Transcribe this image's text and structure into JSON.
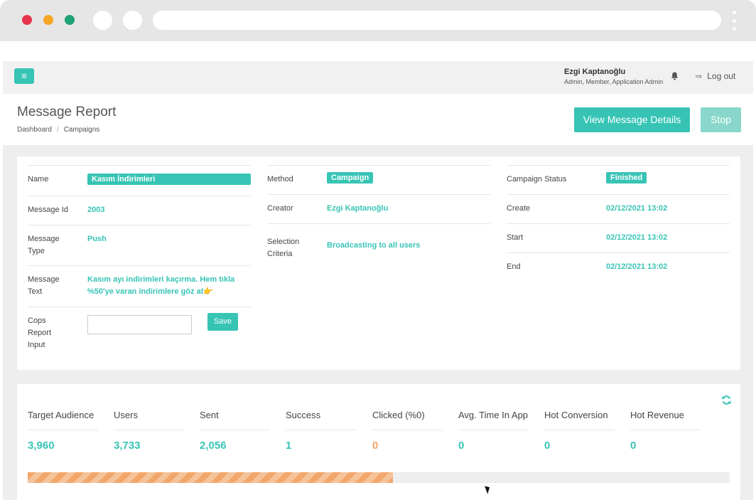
{
  "header": {
    "menu_icon": "hamburger-icon",
    "user_name": "Ezgi Kaptanoğlu",
    "user_role": "Admin, Member, Application Admin",
    "bell_icon": "bell-icon",
    "logout_label": "Log out"
  },
  "page": {
    "title": "Message Report",
    "breadcrumb": [
      "Dashboard",
      "Campaigns"
    ],
    "view_details_label": "View Message Details",
    "stop_label": "Stop"
  },
  "details": {
    "name_label": "Name",
    "name_value": "Kasım İndirimleri",
    "message_id_label": "Message Id",
    "message_id_value": "2003",
    "message_type_label_1": "Message",
    "message_type_label_2": "Type",
    "message_type_value": "Push",
    "message_text_label_1": "Message",
    "message_text_label_2": "Text",
    "message_text_line1": "Kasım ayı indirimleri kaçırma. Hem tıkla",
    "message_text_line2": "%50'ye varan indirimlere göz at👉",
    "cops_label_1": "Cops",
    "cops_label_2": "Report",
    "cops_label_3": "Input",
    "cops_input_value": "",
    "save_label": "Save",
    "method_label": "Method",
    "method_value": "Campaign",
    "creator_label": "Creator",
    "creator_value": "Ezgi Kaptanoğlu",
    "selection_label_1": "Selection",
    "selection_label_2": "Criteria",
    "selection_value": "Broadcasting to all users",
    "status_label": "Campaign Status",
    "status_value": "Finished",
    "create_label": "Create",
    "create_value": "02/12/2021 13:02",
    "start_label": "Start",
    "start_value": "02/12/2021 13:02",
    "end_label": "End",
    "end_value": "02/12/2021 13:02"
  },
  "stats": {
    "items": [
      {
        "label": "Target Audience",
        "value": "3,960"
      },
      {
        "label": "Users",
        "value": "3,733"
      },
      {
        "label": "Sent",
        "value": "2,056"
      },
      {
        "label": "Success",
        "value": "1"
      },
      {
        "label": "Clicked (%0)",
        "value": "0"
      },
      {
        "label": "Avg. Time In App",
        "value": "0"
      },
      {
        "label": "Hot Conversion",
        "value": "0"
      },
      {
        "label": "Hot Revenue",
        "value": "0"
      }
    ],
    "progress_fraction": 0.52,
    "refresh_icon": "refresh-icon"
  },
  "colors": {
    "accent": "#37c4b5",
    "accent_light": "#89d7cb",
    "orange": "#f0a466"
  }
}
